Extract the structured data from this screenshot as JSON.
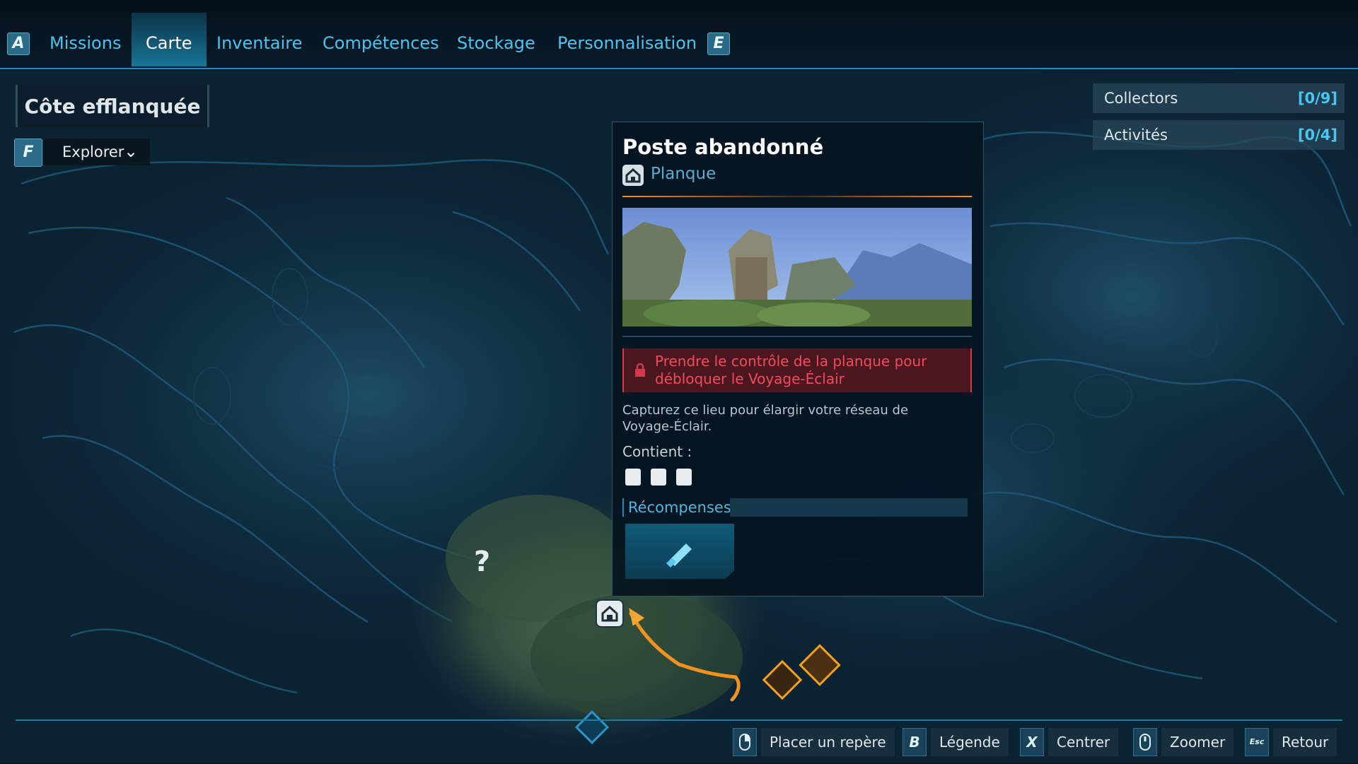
{
  "tabs": {
    "left_key": "A",
    "right_key": "E",
    "items": [
      {
        "label": "Missions",
        "active": false
      },
      {
        "label": "Carte",
        "active": true
      },
      {
        "label": "Inventaire",
        "active": false
      },
      {
        "label": "Compétences",
        "active": false
      },
      {
        "label": "Stockage",
        "active": false
      },
      {
        "label": "Personnalisation",
        "active": false
      }
    ]
  },
  "region": {
    "name": "Côte efflanquée",
    "filter_key": "F",
    "filter_label": "Explorer"
  },
  "counters": [
    {
      "label": "Collectors",
      "value": "[0/9]"
    },
    {
      "label": "Activités",
      "value": "[0/4]"
    }
  ],
  "panel": {
    "title": "Poste abandonné",
    "type_label": "Planque",
    "type_icon": "hideout-icon",
    "lock_message": "Prendre le contrôle de la planque pour débloquer le Voyage-Éclair",
    "description": "Capturez ce lieu pour élargir votre réseau de Voyage-Éclair.",
    "contains_label": "Contient :",
    "contains_icons": [
      "loot-chest-icon",
      "crafting-box-icon",
      "collectible-icon"
    ],
    "rewards_label": "Récompenses",
    "reward_icon": "crystal-shard-icon"
  },
  "map": {
    "unknown_marker": "?",
    "markers": [
      "hideout-marker",
      "objective-diamond-marker",
      "objective-diamond-marker",
      "player-location-marker"
    ]
  },
  "hints": [
    {
      "key": "mouse-right-icon",
      "label": "Placer un repère"
    },
    {
      "key": "B",
      "label": "Légende"
    },
    {
      "key": "X",
      "label": "Centrer"
    },
    {
      "key": "mouse-wheel-icon",
      "label": "Zoomer"
    },
    {
      "key": "Esc",
      "label": "Retour"
    }
  ],
  "colors": {
    "accent": "#47c6f2",
    "active_tab": "#1a7594",
    "route": "#f3931f",
    "lock_red": "#f24a5c",
    "map_dark": "#0a2232"
  }
}
